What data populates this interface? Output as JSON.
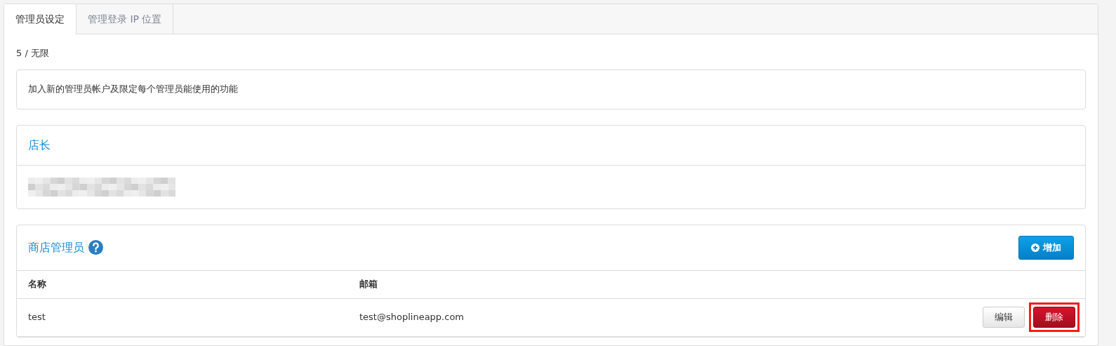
{
  "tabs": [
    {
      "label": "管理员设定",
      "selected": true
    },
    {
      "label": "管理登录 IP 位置",
      "selected": false
    }
  ],
  "quota": "5 / 无限",
  "description": "加入新的管理员帐户及限定每个管理员能使用的功能",
  "owner": {
    "title": "店长"
  },
  "admins": {
    "title": "商店管理员",
    "add_button": "增加",
    "columns": [
      "名称",
      "邮箱"
    ],
    "rows": [
      {
        "name": "test",
        "email": "test@shoplineapp.com",
        "actions": [
          {
            "kind": "edit",
            "label": "编辑",
            "highlighted": false
          },
          {
            "kind": "delete",
            "label": "删除",
            "highlighted": true
          }
        ]
      }
    ]
  }
}
